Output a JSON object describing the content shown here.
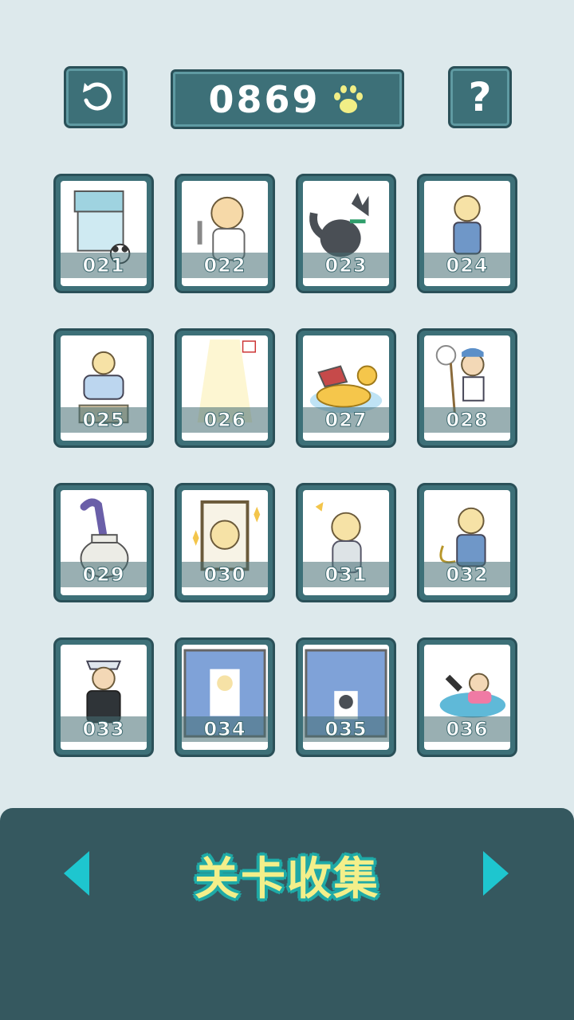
{
  "header": {
    "score": "0869",
    "back_icon": "undo-arrow-icon",
    "help_label": "?",
    "currency_icon": "paw-icon",
    "paw_color": "#f1ee86"
  },
  "levels": [
    {
      "number": "021",
      "icon": "claw-machine-panda"
    },
    {
      "number": "022",
      "icon": "angry-girl-hammer"
    },
    {
      "number": "023",
      "icon": "husky-dog"
    },
    {
      "number": "024",
      "icon": "boy-overalls-angry"
    },
    {
      "number": "025",
      "icon": "boy-in-box"
    },
    {
      "number": "026",
      "icon": "light-beam"
    },
    {
      "number": "027",
      "icon": "duck-float-cake"
    },
    {
      "number": "028",
      "icon": "boy-bug-net"
    },
    {
      "number": "029",
      "icon": "snake-vase"
    },
    {
      "number": "030",
      "icon": "mirror-girl"
    },
    {
      "number": "031",
      "icon": "cat-costume-boy"
    },
    {
      "number": "032",
      "icon": "boy-overalls-tail"
    },
    {
      "number": "033",
      "icon": "police-officer"
    },
    {
      "number": "034",
      "icon": "boy-in-wardrobe"
    },
    {
      "number": "035",
      "icon": "dog-in-wardrobe"
    },
    {
      "number": "036",
      "icon": "fall-pool"
    }
  ],
  "footer": {
    "title": "关卡收集",
    "prev_icon": "arrow-left-icon",
    "next_icon": "arrow-right-icon",
    "accent": "#1ec6cf"
  }
}
